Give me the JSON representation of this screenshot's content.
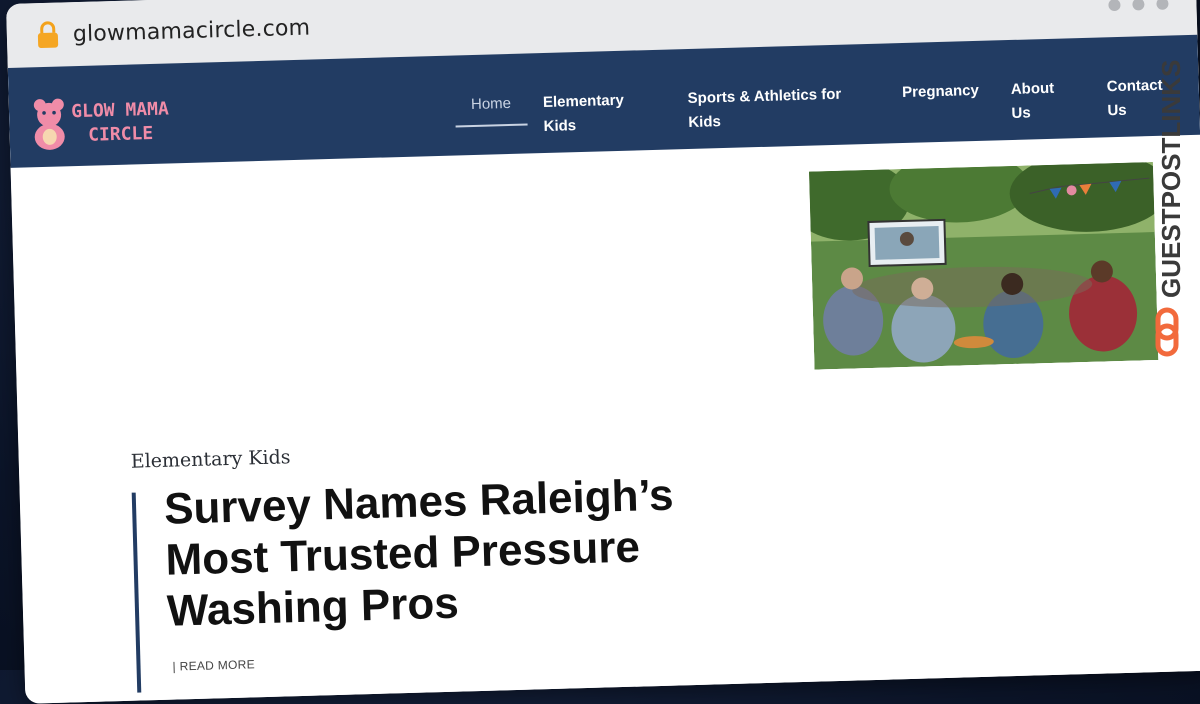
{
  "browser": {
    "url": "glowmamacircle.com",
    "lock_icon": "lock-icon"
  },
  "site": {
    "logo_line1": "GLOW MAMA",
    "logo_line2": "CIRCLE",
    "nav": [
      {
        "label": "Home",
        "active": true
      },
      {
        "label": "Elementary Kids"
      },
      {
        "label": "Sports & Athletics for Kids"
      },
      {
        "label": "Pregnancy"
      },
      {
        "label": "About Us"
      },
      {
        "label": "Contact Us"
      }
    ]
  },
  "post": {
    "category": "Elementary Kids",
    "title": "Survey Names Raleigh’s Most Trusted Pressure Washing Pros",
    "read_more": "| READ MORE"
  },
  "watermark": {
    "text": "GUESTPOSTLINKS"
  },
  "colors": {
    "nav_bg": "#223c63",
    "logo_pink": "#f08ca8",
    "watermark_orange": "#f26a3c"
  }
}
